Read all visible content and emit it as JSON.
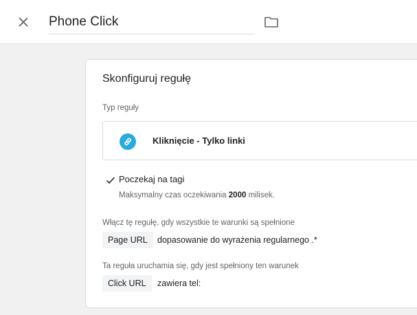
{
  "header": {
    "title": "Phone Click",
    "close_icon": "close-icon",
    "folder_icon": "folder-icon"
  },
  "card": {
    "title": "Skonfiguruj regułę",
    "type_label": "Typ reguły",
    "type_name": "Kliknięcie - Tylko linki",
    "type_icon": "link-icon",
    "type_icon_color": "#29a9e0",
    "wait": {
      "label": "Poczekaj na tagi",
      "desc_prefix": "Maksymalny czas oczekiwania ",
      "desc_value": "2000",
      "desc_suffix": " milisek.",
      "checked": true
    },
    "enable_label": "Włącz tę regułę, gdy wszystkie te warunki są spełnione",
    "enable_condition": {
      "variable": "Page URL",
      "operator_value": "dopasowanie do wyrażenia regularnego .*"
    },
    "fire_label": "Ta reguła uruchamia się, gdy jest spełniony ten warunek",
    "fire_condition": {
      "variable": "Click URL",
      "operator_value": "zawiera tel:"
    }
  }
}
